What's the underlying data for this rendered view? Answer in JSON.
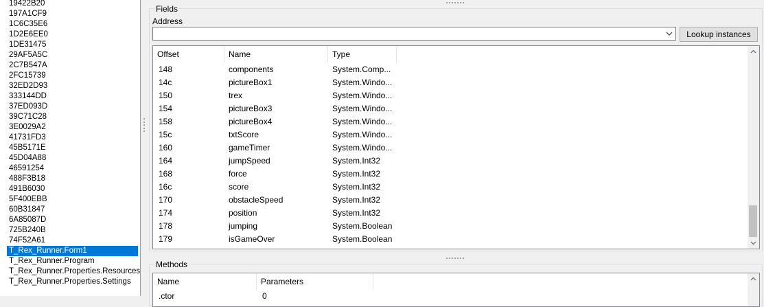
{
  "left_list": {
    "items": [
      "19422B20",
      "197A1CF9",
      "1C6C35E6",
      "1D2E6EE0",
      "1DE31475",
      "29AF5A5C",
      "2C7B547A",
      "2FC15739",
      "32ED2D93",
      "333144DD",
      "37ED093D",
      "39C71C28",
      "3E0029A2",
      "41731FD3",
      "45B5171E",
      "45D04A88",
      "46591254",
      "488F3B18",
      "491B6030",
      "5F400EBB",
      "60B31847",
      "6A85087D",
      "725B240B",
      "74F52A61",
      "T_Rex_Runner.Form1",
      "T_Rex_Runner.Program",
      "T_Rex_Runner.Properties.Resources",
      "T_Rex_Runner.Properties.Settings"
    ],
    "selected": "T_Rex_Runner.Form1"
  },
  "fields": {
    "title": "Fields",
    "address_label": "Address",
    "address_value": "",
    "lookup_button": "Lookup instances",
    "columns": [
      "Offset",
      "Name",
      "Type"
    ],
    "rows": [
      [
        "148",
        "components",
        "System.Comp..."
      ],
      [
        "14c",
        "pictureBox1",
        "System.Windo..."
      ],
      [
        "150",
        "trex",
        "System.Windo..."
      ],
      [
        "154",
        "pictureBox3",
        "System.Windo..."
      ],
      [
        "158",
        "pictureBox4",
        "System.Windo..."
      ],
      [
        "15c",
        "txtScore",
        "System.Windo..."
      ],
      [
        "160",
        "gameTimer",
        "System.Windo..."
      ],
      [
        "164",
        "jumpSpeed",
        "System.Int32"
      ],
      [
        "168",
        "force",
        "System.Int32"
      ],
      [
        "16c",
        "score",
        "System.Int32"
      ],
      [
        "170",
        "obstacleSpeed",
        "System.Int32"
      ],
      [
        "174",
        "position",
        "System.Int32"
      ],
      [
        "178",
        "jumping",
        "System.Boolean"
      ],
      [
        "179",
        "isGameOver",
        "System.Boolean"
      ]
    ]
  },
  "methods": {
    "title": "Methods",
    "columns": [
      "Name",
      "Parameters"
    ],
    "rows": [
      [
        ".ctor",
        "0"
      ]
    ]
  }
}
